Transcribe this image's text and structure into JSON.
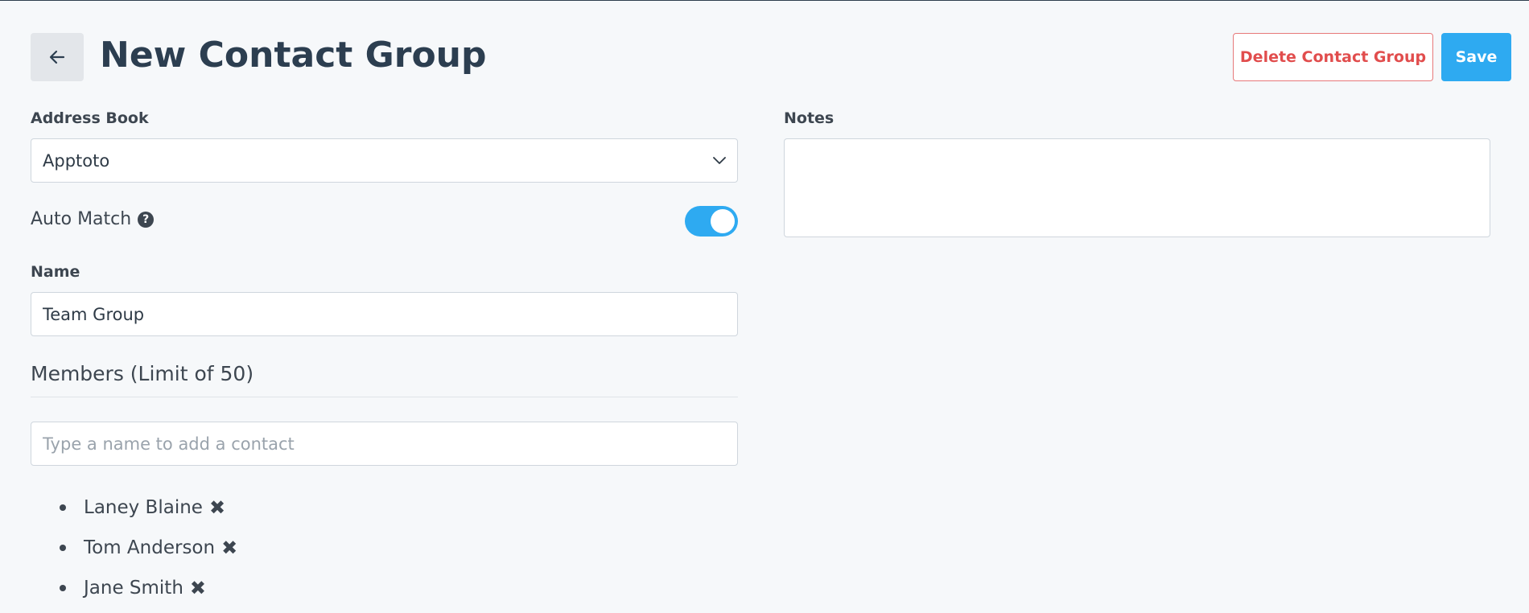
{
  "header": {
    "title": "New Contact Group",
    "delete_label": "Delete Contact Group",
    "save_label": "Save",
    "back_icon": "arrow-left-icon"
  },
  "form": {
    "address_book": {
      "label": "Address Book",
      "value": "Apptoto",
      "icon": "chevron-down-icon"
    },
    "auto_match": {
      "label": "Auto Match",
      "help_icon": "question-circle-icon",
      "help_glyph": "?",
      "enabled": true
    },
    "name": {
      "label": "Name",
      "value": "Team Group"
    },
    "members": {
      "heading": "Members (Limit of 50)",
      "placeholder": "Type a name to add a contact",
      "remove_glyph": "✖",
      "items": [
        {
          "name": "Laney Blaine"
        },
        {
          "name": "Tom Anderson"
        },
        {
          "name": "Jane Smith"
        }
      ]
    },
    "notes": {
      "label": "Notes",
      "value": ""
    }
  },
  "colors": {
    "accent": "#2eaaf1",
    "danger": "#e14d4d",
    "background": "#f6f8fa",
    "title_text": "#2c3e50"
  }
}
